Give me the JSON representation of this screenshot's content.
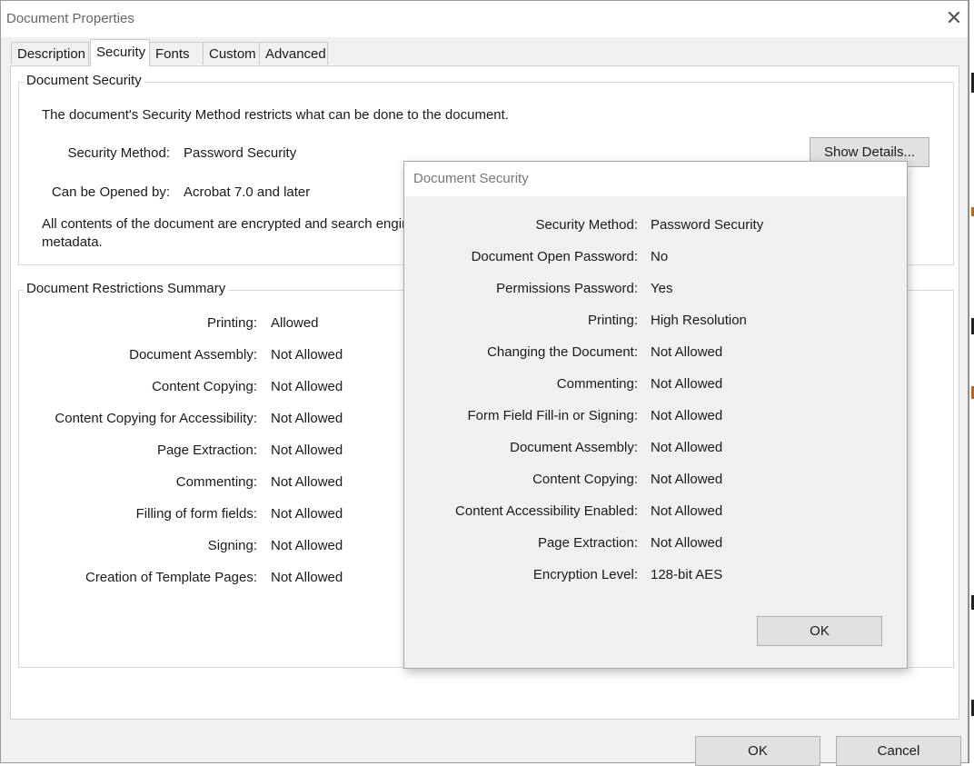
{
  "window": {
    "title": "Document Properties"
  },
  "tabs": [
    {
      "label": "Description"
    },
    {
      "label": "Security",
      "active": true
    },
    {
      "label": "Fonts"
    },
    {
      "label": "Custom"
    },
    {
      "label": "Advanced"
    }
  ],
  "document_security": {
    "group_label": "Document Security",
    "intro": "The document's Security Method restricts what can be done to the document.",
    "method_label": "Security Method:",
    "method_value": "Password Security",
    "show_details_label": "Show Details...",
    "opened_label": "Can be Opened by:",
    "opened_value": "Acrobat 7.0 and later",
    "encryption_text_line1": "All contents of the document are encrypted and search engin",
    "encryption_text_line2": "metadata."
  },
  "restrictions": {
    "group_label": "Document Restrictions Summary",
    "rows": [
      {
        "label": "Printing:",
        "value": "Allowed"
      },
      {
        "label": "Document Assembly:",
        "value": "Not Allowed"
      },
      {
        "label": "Content Copying:",
        "value": "Not Allowed"
      },
      {
        "label": "Content Copying for Accessibility:",
        "value": "Not Allowed"
      },
      {
        "label": "Page Extraction:",
        "value": "Not Allowed"
      },
      {
        "label": "Commenting:",
        "value": "Not Allowed"
      },
      {
        "label": "Filling of form fields:",
        "value": "Not Allowed"
      },
      {
        "label": "Signing:",
        "value": "Not Allowed"
      },
      {
        "label": "Creation of Template Pages:",
        "value": "Not Allowed"
      }
    ]
  },
  "footer": {
    "ok_label": "OK",
    "cancel_label": "Cancel"
  },
  "security_dialog": {
    "title": "Document Security",
    "rows": [
      {
        "label": "Security Method:",
        "value": "Password Security"
      },
      {
        "label": "Document Open Password:",
        "value": "No"
      },
      {
        "label": "Permissions Password:",
        "value": "Yes"
      },
      {
        "label": "Printing:",
        "value": "High Resolution"
      },
      {
        "label": "Changing the Document:",
        "value": "Not Allowed"
      },
      {
        "label": "Commenting:",
        "value": "Not Allowed"
      },
      {
        "label": "Form Field Fill-in or Signing:",
        "value": "Not Allowed"
      },
      {
        "label": "Document Assembly:",
        "value": "Not Allowed"
      },
      {
        "label": "Content Copying:",
        "value": "Not Allowed"
      },
      {
        "label": "Content Accessibility Enabled:",
        "value": "Not Allowed"
      },
      {
        "label": "Page Extraction:",
        "value": "Not Allowed"
      },
      {
        "label": "Encryption Level:",
        "value": "128-bit AES"
      }
    ],
    "ok_label": "OK"
  }
}
